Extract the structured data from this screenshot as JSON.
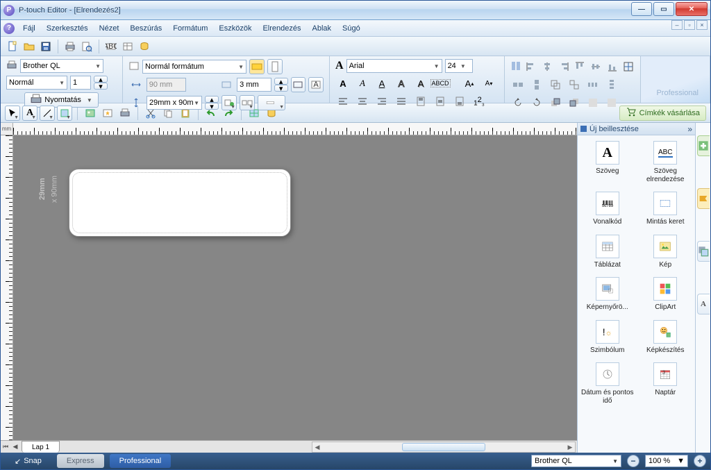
{
  "window": {
    "title": "P-touch Editor - [Elrendezés2]",
    "app_icon_glyph": "P"
  },
  "menu": {
    "items": [
      "Fájl",
      "Szerkesztés",
      "Nézet",
      "Beszúrás",
      "Formátum",
      "Eszközök",
      "Elrendezés",
      "Ablak",
      "Súgó"
    ]
  },
  "ribbon": {
    "printer": {
      "name": "Brother QL",
      "mode": "Normál",
      "copies": "1",
      "print_label": "Nyomtatás"
    },
    "paper": {
      "format": "Normál formátum",
      "width": "90 mm",
      "height": "3 mm",
      "size": "29mm x 90m"
    },
    "font": {
      "name": "Arial",
      "size": "24"
    },
    "pro_label": "Professional",
    "buy_label": "Címkék vásárlása"
  },
  "ruler_unit": "mm",
  "canvas": {
    "dim_line1": "29mm",
    "dim_line2": "x 90mm"
  },
  "sheet": {
    "tab": "Lap 1"
  },
  "sidepanel": {
    "header": "Új beillesztése",
    "items": [
      {
        "label": "Szöveg",
        "glyph": "A"
      },
      {
        "label": "Szöveg elrendezése",
        "glyph": "ABC"
      },
      {
        "label": "Vonalkód",
        "glyph": "▮▮▮▮"
      },
      {
        "label": "Mintás keret",
        "glyph": "▦"
      },
      {
        "label": "Táblázat",
        "glyph": "▦"
      },
      {
        "label": "Kép",
        "glyph": "▣"
      },
      {
        "label": "Képernyőrö...",
        "glyph": "▧"
      },
      {
        "label": "ClipArt",
        "glyph": "◪"
      },
      {
        "label": "Szimbólum",
        "glyph": "!☼"
      },
      {
        "label": "Képkészítés",
        "glyph": "☻"
      },
      {
        "label": "Dátum és pontos idő",
        "glyph": "◷"
      },
      {
        "label": "Naptár",
        "glyph": "▤"
      }
    ]
  },
  "status": {
    "snap": "Snap",
    "express": "Express",
    "professional": "Professional",
    "printer": "Brother QL",
    "zoom": "100 %"
  }
}
